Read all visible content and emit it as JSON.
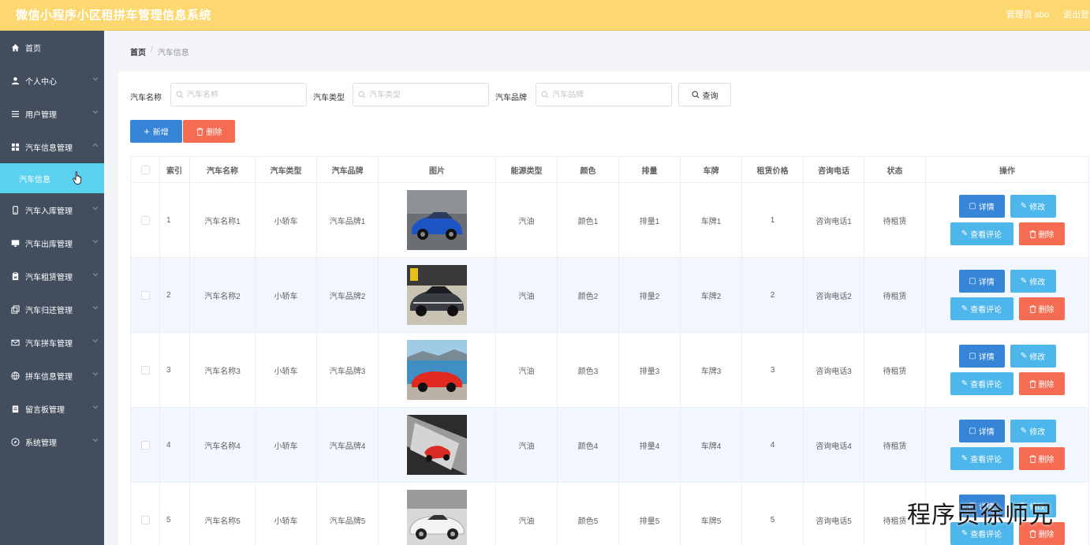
{
  "header": {
    "title": "微信小程序小区租拼车管理信息系统",
    "admin_label": "管理员 abo",
    "logout_label": "退出登录"
  },
  "sidebar": {
    "items": [
      {
        "label": "首页",
        "icon": "home-icon",
        "has_chevron": false
      },
      {
        "label": "个人中心",
        "icon": "user-icon",
        "has_chevron": true
      },
      {
        "label": "用户管理",
        "icon": "list-icon",
        "has_chevron": true
      },
      {
        "label": "汽车信息管理",
        "icon": "grid-icon",
        "has_chevron": true,
        "expanded": true
      },
      {
        "label": "汽车入库管理",
        "icon": "phone-icon",
        "has_chevron": true
      },
      {
        "label": "汽车出库管理",
        "icon": "monitor-icon",
        "has_chevron": true
      },
      {
        "label": "汽车租赁管理",
        "icon": "clipboard-icon",
        "has_chevron": true
      },
      {
        "label": "汽车归还管理",
        "icon": "copy-icon",
        "has_chevron": true
      },
      {
        "label": "汽车拼车管理",
        "icon": "mail-icon",
        "has_chevron": true
      },
      {
        "label": "拼车信息管理",
        "icon": "globe-icon",
        "has_chevron": true
      },
      {
        "label": "留言板管理",
        "icon": "board-icon",
        "has_chevron": true
      },
      {
        "label": "系统管理",
        "icon": "compass-icon",
        "has_chevron": true
      }
    ],
    "active_subitem": "汽车信息"
  },
  "breadcrumb": {
    "home": "首页",
    "separator": "/",
    "current": "汽车信息"
  },
  "search": {
    "name_label": "汽车名称",
    "name_placeholder": "汽车名称",
    "type_label": "汽车类型",
    "type_placeholder": "汽车类型",
    "brand_label": "汽车品牌",
    "brand_placeholder": "汽车品牌",
    "query_label": "查询"
  },
  "actions": {
    "add_label": "新增",
    "delete_label": "删除"
  },
  "table": {
    "headers": [
      "索引",
      "汽车名称",
      "汽车类型",
      "汽车品牌",
      "图片",
      "能源类型",
      "颜色",
      "排量",
      "车牌",
      "租赁价格",
      "咨询电话",
      "状态",
      "操作"
    ],
    "rows": [
      {
        "index": "1",
        "name": "汽车名称1",
        "type": "小轿车",
        "brand": "汽车品牌1",
        "energy": "汽油",
        "color": "颜色1",
        "displacement": "排量1",
        "plate": "车牌1",
        "price": "1",
        "phone": "咨询电话1",
        "status": "待租赁"
      },
      {
        "index": "2",
        "name": "汽车名称2",
        "type": "小轿车",
        "brand": "汽车品牌2",
        "energy": "汽油",
        "color": "颜色2",
        "displacement": "排量2",
        "plate": "车牌2",
        "price": "2",
        "phone": "咨询电话2",
        "status": "待租赁"
      },
      {
        "index": "3",
        "name": "汽车名称3",
        "type": "小轿车",
        "brand": "汽车品牌3",
        "energy": "汽油",
        "color": "颜色3",
        "displacement": "排量3",
        "plate": "车牌3",
        "price": "3",
        "phone": "咨询电话3",
        "status": "待租赁"
      },
      {
        "index": "4",
        "name": "汽车名称4",
        "type": "小轿车",
        "brand": "汽车品牌4",
        "energy": "汽油",
        "color": "颜色4",
        "displacement": "排量4",
        "plate": "车牌4",
        "price": "4",
        "phone": "咨询电话4",
        "status": "待租赁"
      },
      {
        "index": "5",
        "name": "汽车名称5",
        "type": "小轿车",
        "brand": "汽车品牌5",
        "energy": "汽油",
        "color": "颜色5",
        "displacement": "排量5",
        "plate": "车牌5",
        "price": "5",
        "phone": "咨询电话5",
        "status": "待租赁"
      }
    ],
    "row_buttons": {
      "detail": "详情",
      "edit": "修改",
      "comment": "查看评论",
      "delete": "删除"
    }
  },
  "watermark": "程序员徐师兄",
  "colors": {
    "header": "#fdd770",
    "sidebar": "#424d5e",
    "active_sub": "#5bd2f0",
    "primary": "#3685d6",
    "info": "#4db6ea",
    "danger": "#f56c53",
    "stripe": "#f2f7fd"
  }
}
